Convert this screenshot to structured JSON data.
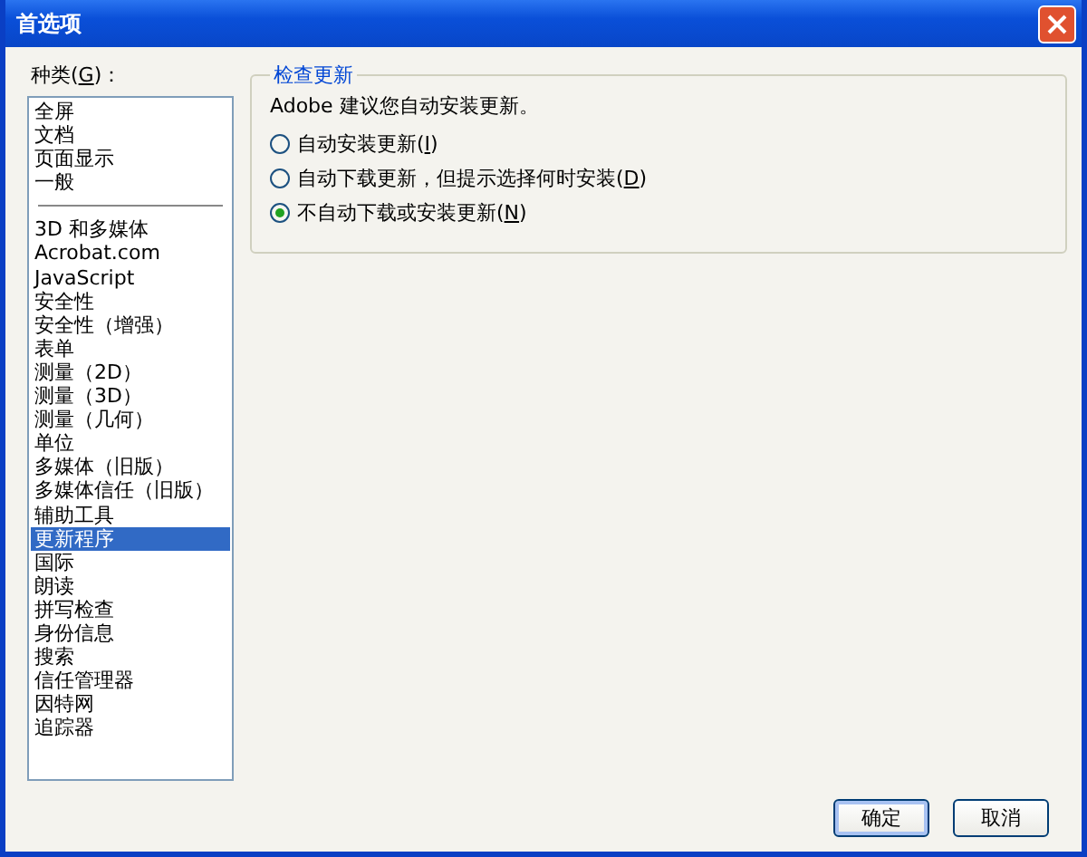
{
  "window": {
    "title": "首选项"
  },
  "categories": {
    "label": {
      "before": "种类(",
      "key": "G",
      "after": ")："
    },
    "groups": [
      {
        "items": [
          {
            "label": "全屏",
            "selected": false
          },
          {
            "label": "文档",
            "selected": false
          },
          {
            "label": "页面显示",
            "selected": false
          },
          {
            "label": "一般",
            "selected": false
          }
        ]
      },
      {
        "items": [
          {
            "label": "3D 和多媒体",
            "selected": false
          },
          {
            "label": "Acrobat.com",
            "selected": false
          },
          {
            "label": "JavaScript",
            "selected": false
          },
          {
            "label": "安全性",
            "selected": false
          },
          {
            "label": "安全性（增强）",
            "selected": false
          },
          {
            "label": "表单",
            "selected": false
          },
          {
            "label": "测量（2D）",
            "selected": false
          },
          {
            "label": "测量（3D）",
            "selected": false
          },
          {
            "label": "测量（几何）",
            "selected": false
          },
          {
            "label": "单位",
            "selected": false
          },
          {
            "label": "多媒体（旧版）",
            "selected": false
          },
          {
            "label": "多媒体信任（旧版）",
            "selected": false
          },
          {
            "label": "辅助工具",
            "selected": false
          },
          {
            "label": "更新程序",
            "selected": true
          },
          {
            "label": "国际",
            "selected": false
          },
          {
            "label": "朗读",
            "selected": false
          },
          {
            "label": "拼写检查",
            "selected": false
          },
          {
            "label": "身份信息",
            "selected": false
          },
          {
            "label": "搜索",
            "selected": false
          },
          {
            "label": "信任管理器",
            "selected": false
          },
          {
            "label": "因特网",
            "selected": false
          },
          {
            "label": "追踪器",
            "selected": false
          }
        ]
      }
    ]
  },
  "update_group": {
    "title": "检查更新",
    "note": "Adobe 建议您自动安装更新。",
    "options": [
      {
        "before": "自动安装更新(",
        "key": "I",
        "after": ")",
        "selected": false
      },
      {
        "before": "自动下载更新，但提示选择何时安装(",
        "key": "D",
        "after": ")",
        "selected": false
      },
      {
        "before": "不自动下载或安装更新(",
        "key": "N",
        "after": ")",
        "selected": true
      }
    ]
  },
  "buttons": [
    {
      "label": "确定",
      "default": true
    },
    {
      "label": "取消",
      "default": false
    }
  ]
}
